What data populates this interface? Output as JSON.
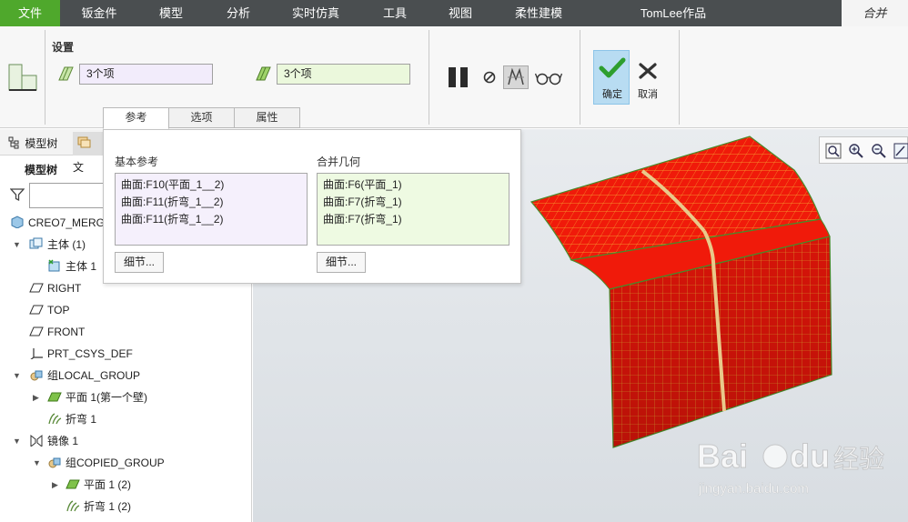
{
  "menubar": {
    "file": "文件",
    "items": [
      "钣金件",
      "模型",
      "分析",
      "实时仿真",
      "工具",
      "视图",
      "柔性建模",
      "TomLee作品"
    ],
    "active_tab": "合并",
    "colors": {
      "bar": "#4a4e50",
      "file": "#4fa82c"
    }
  },
  "ribbon": {
    "group_label": "设置",
    "primary_selection": "3个项",
    "secondary_selection": "3个项",
    "ok_label": "确定",
    "cancel_label": "取消",
    "icons": [
      "merge-type-icon",
      "surface-collector-icon",
      "surface-collector-icon",
      "pause-icon",
      "no-preview-icon",
      "verify-icon",
      "preview-glasses-icon",
      "checkmark-icon",
      "x-icon"
    ]
  },
  "tabs": [
    "参考",
    "选项",
    "属性"
  ],
  "references": {
    "base_label": "基本参考",
    "base_items": [
      "曲面:F10(平面_1__2)",
      "曲面:F11(折弯_1__2)",
      "曲面:F11(折弯_1__2)"
    ],
    "merge_label": "合并几何",
    "merge_items": [
      "曲面:F6(平面_1)",
      "曲面:F7(折弯_1)",
      "曲面:F7(折弯_1)"
    ],
    "details_button": "细节..."
  },
  "tree": {
    "tab_model": "模型树",
    "tab_layer": "文",
    "title": "模型树",
    "filter_placeholder": "",
    "rows": [
      "CREO7_MERG",
      "主体 (1)",
      "主体 1",
      "RIGHT",
      "TOP",
      "FRONT",
      "PRT_CSYS_DEF",
      "组LOCAL_GROUP",
      "平面 1(第一个壁)",
      "折弯 1",
      "镜像 1",
      "组COPIED_GROUP",
      "平面 1 (2)",
      "折弯 1 (2)"
    ]
  },
  "watermark": {
    "brand": "Bai",
    "brand_du": "du",
    "brand_suffix": "经验",
    "url": "jingyan.baidu.com"
  }
}
